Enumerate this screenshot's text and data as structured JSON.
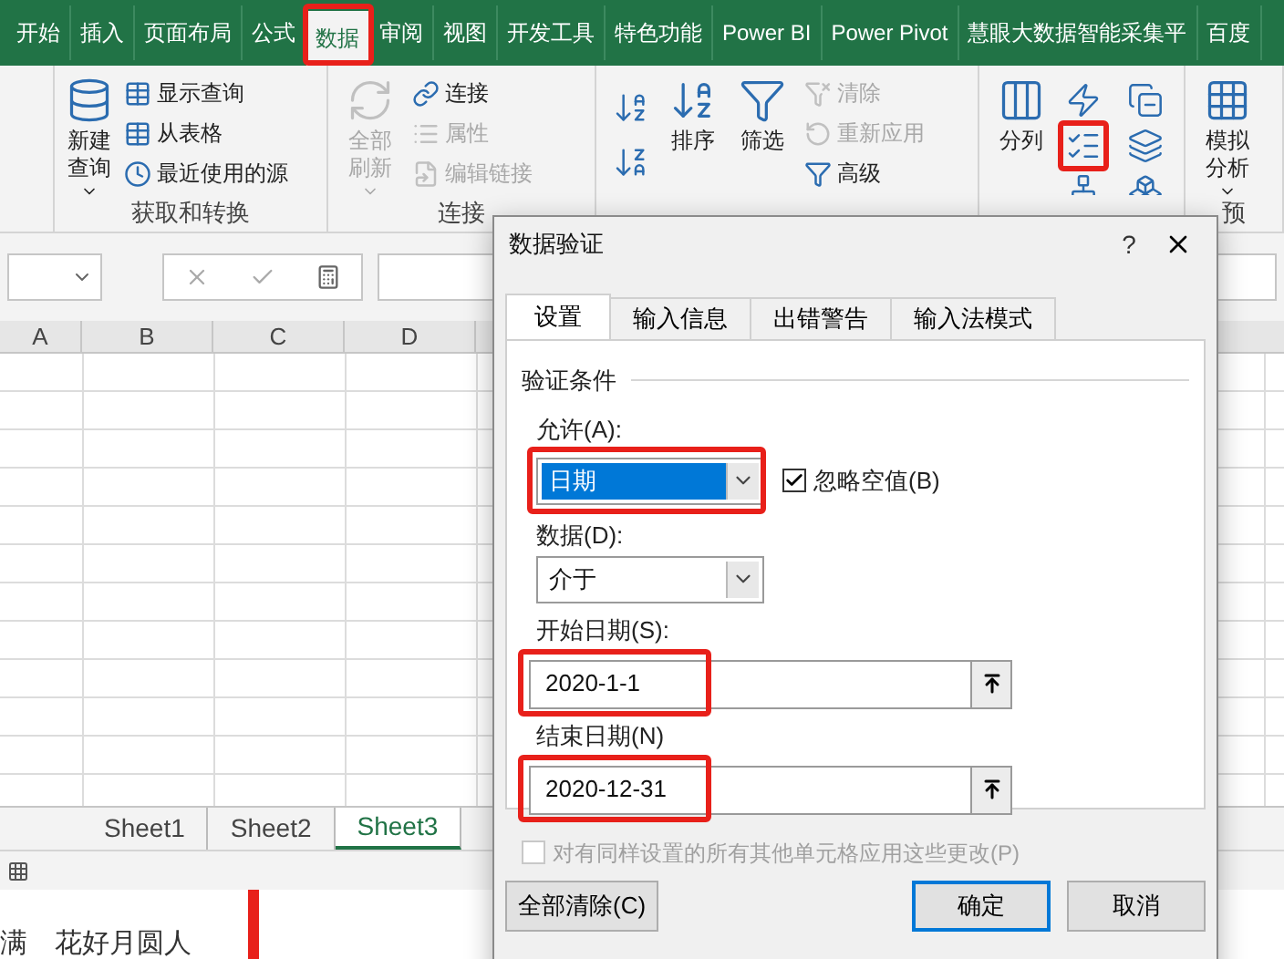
{
  "ribbon": {
    "tabs": [
      {
        "label": "开始",
        "selected": false,
        "highlighted": false
      },
      {
        "label": "插入",
        "selected": false,
        "highlighted": false
      },
      {
        "label": "页面布局",
        "selected": false,
        "highlighted": false
      },
      {
        "label": "公式",
        "selected": false,
        "highlighted": false
      },
      {
        "label": "数据",
        "selected": true,
        "highlighted": true
      },
      {
        "label": "审阅",
        "selected": false,
        "highlighted": false
      },
      {
        "label": "视图",
        "selected": false,
        "highlighted": false
      },
      {
        "label": "开发工具",
        "selected": false,
        "highlighted": false
      },
      {
        "label": "特色功能",
        "selected": false,
        "highlighted": false
      },
      {
        "label": "Power BI",
        "selected": false,
        "highlighted": false
      },
      {
        "label": "Power Pivot",
        "selected": false,
        "highlighted": false
      },
      {
        "label": "慧眼大数据智能采集平",
        "selected": false,
        "highlighted": false
      },
      {
        "label": "百度",
        "selected": false,
        "highlighted": false
      }
    ],
    "groups": [
      {
        "label": "获取和转换",
        "buttons": [
          {
            "kind": "large",
            "label": "新建查询",
            "disabled": false,
            "dropdown": true
          },
          {
            "kind": "small",
            "label": "显示查询",
            "disabled": false
          },
          {
            "kind": "small",
            "label": "从表格",
            "disabled": false
          },
          {
            "kind": "small",
            "label": "最近使用的源",
            "disabled": false
          }
        ]
      },
      {
        "label": "连接",
        "buttons": [
          {
            "kind": "large",
            "label": "全部刷新",
            "disabled": true,
            "dropdown": true
          },
          {
            "kind": "small",
            "label": "连接",
            "disabled": false
          },
          {
            "kind": "small",
            "label": "属性",
            "disabled": true
          },
          {
            "kind": "small",
            "label": "编辑链接",
            "disabled": true
          }
        ]
      },
      {
        "buttons": [
          {
            "kind": "icon",
            "highlighted": false
          },
          {
            "kind": "icon",
            "highlighted": false
          },
          {
            "kind": "large",
            "label": "排序",
            "disabled": false,
            "dropdown": false
          },
          {
            "kind": "large",
            "label": "筛选",
            "disabled": false,
            "dropdown": false
          },
          {
            "kind": "small",
            "label": "清除",
            "disabled": true
          },
          {
            "kind": "small",
            "label": "重新应用",
            "disabled": true
          },
          {
            "kind": "small",
            "label": "高级",
            "disabled": false
          }
        ]
      },
      {
        "buttons": [
          {
            "kind": "large",
            "label": "分列",
            "disabled": false,
            "dropdown": false
          },
          {
            "kind": "icon",
            "highlighted": false
          },
          {
            "kind": "icon",
            "highlighted": false
          },
          {
            "kind": "icon",
            "highlighted": true
          },
          {
            "kind": "icon",
            "highlighted": false
          },
          {
            "kind": "icon",
            "highlighted": false
          },
          {
            "kind": "icon",
            "highlighted": false
          }
        ]
      },
      {
        "label": "预",
        "buttons": [
          {
            "kind": "large",
            "label": "模拟分析",
            "disabled": false,
            "dropdown": true
          }
        ]
      }
    ]
  },
  "sheet": {
    "columns": [
      "A",
      "B",
      "C",
      "D"
    ]
  },
  "sheet_tabs": [
    {
      "label": "Sheet1",
      "selected": false
    },
    {
      "label": "Sheet2",
      "selected": false
    },
    {
      "label": "Sheet3",
      "selected": true
    }
  ],
  "background_text": "满　花好月圆人",
  "dialog": {
    "title": "数据验证",
    "help": "?",
    "tabs": [
      {
        "label": "设置",
        "selected": true
      },
      {
        "label": "输入信息",
        "selected": false
      },
      {
        "label": "出错警告",
        "selected": false
      },
      {
        "label": "输入法模式",
        "selected": false
      }
    ],
    "section": "验证条件",
    "allow": {
      "label": "允许(A):",
      "value": "日期",
      "highlighted": true
    },
    "ignore_blank": {
      "label": "忽略空值(B)",
      "checked": true
    },
    "data": {
      "label": "数据(D):",
      "value": "介于",
      "highlighted": false
    },
    "start": {
      "label": "开始日期(S):",
      "value": "2020-1-1",
      "highlighted": true
    },
    "end": {
      "label": "结束日期(N)",
      "value": "2020-12-31",
      "highlighted": true
    },
    "apply_all": {
      "label": "对有同样设置的所有其他单元格应用这些更改(P)",
      "checked": false,
      "disabled": true
    },
    "buttons": [
      {
        "label": "全部清除(C)",
        "default": false
      },
      {
        "label": "确定",
        "default": true
      },
      {
        "label": "取消",
        "default": false
      }
    ]
  }
}
